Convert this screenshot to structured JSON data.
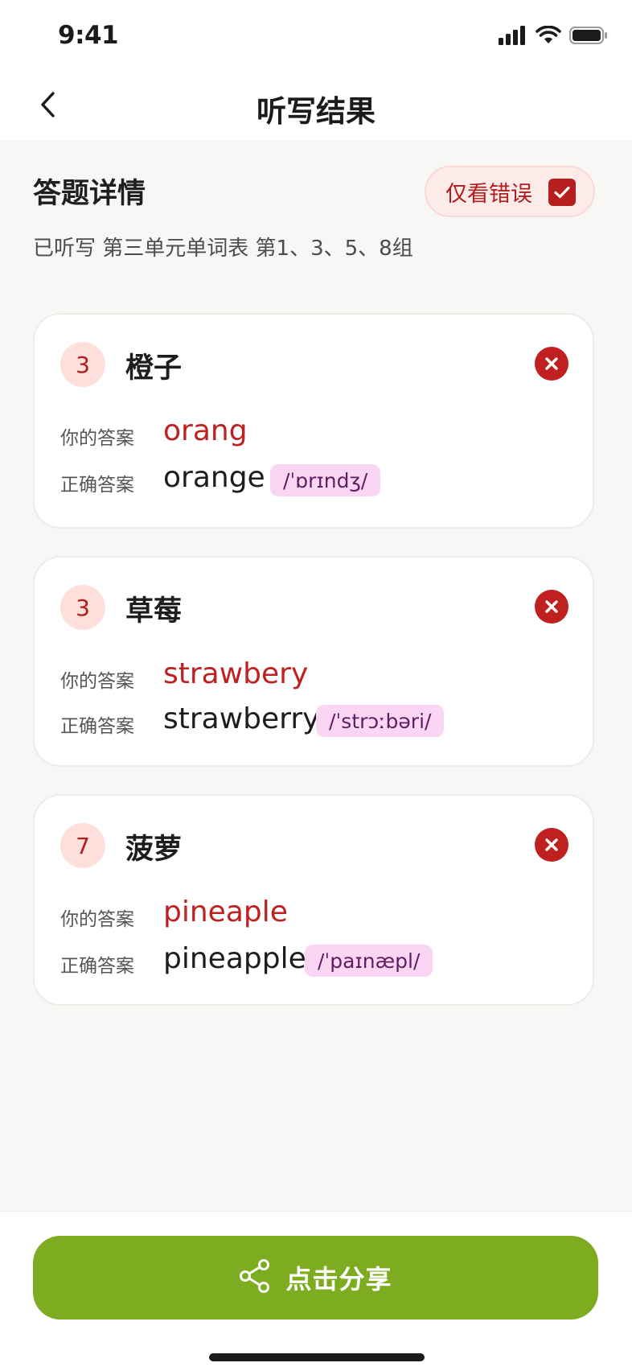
{
  "status_bar": {
    "time": "9:41"
  },
  "nav": {
    "title": "听写结果"
  },
  "section": {
    "title": "答题详情",
    "subtitle": "已听写 第三单元单词表 第1、3、5、8组",
    "filter_label": "仅看错误",
    "filter_checked": true
  },
  "labels": {
    "your_answer": "你的答案",
    "correct_answer": "正确答案"
  },
  "cards": [
    {
      "index": "3",
      "word": "橙子",
      "your_answer": "orang",
      "correct_answer": "orange",
      "phonetic": "/ˈɒrɪndʒ/",
      "status": "wrong"
    },
    {
      "index": "3",
      "word": "草莓",
      "your_answer": "strawbery",
      "correct_answer": "strawberry",
      "phonetic": "/ˈstrɔːbəri/",
      "status": "wrong"
    },
    {
      "index": "7",
      "word": "菠萝",
      "your_answer": "pineaple",
      "correct_answer": "pineapple",
      "phonetic": "/ˈpaɪnæpl/",
      "status": "wrong"
    }
  ],
  "share": {
    "label": "点击分享"
  },
  "colors": {
    "accent_green": "#7eac21",
    "error_red": "#c0201f",
    "phonetic_bg": "#fbd6f4"
  },
  "icons": [
    "back-chevron-icon",
    "signal-icon",
    "wifi-icon",
    "battery-icon",
    "checkbox-check-icon",
    "wrong-x-icon",
    "share-icon"
  ]
}
